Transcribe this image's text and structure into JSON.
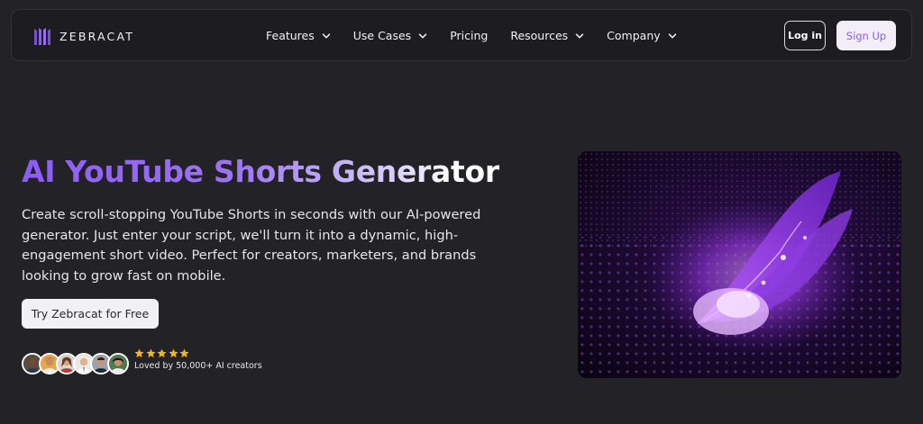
{
  "brand": {
    "name": "ZEBRACAT"
  },
  "nav": {
    "items": [
      {
        "label": "Features",
        "dropdown": true
      },
      {
        "label": "Use Cases",
        "dropdown": true
      },
      {
        "label": "Pricing",
        "dropdown": false
      },
      {
        "label": "Resources",
        "dropdown": true
      },
      {
        "label": "Company",
        "dropdown": true
      }
    ],
    "login_label": "Log in",
    "signup_label": "Sign Up"
  },
  "hero": {
    "title": "AI YouTube Shorts Generator",
    "description": "Create scroll-stopping YouTube Shorts in seconds with our AI-powered generator. Just enter your script, we'll turn it into a dynamic, high-engagement short video. Perfect for creators, marketers, and brands looking to grow fast on mobile.",
    "cta_label": "Try Zebracat for Free",
    "rating_stars": 5,
    "social_proof": "Loved by 50,000+ AI creators",
    "avatar_count": 6
  },
  "colors": {
    "background": "#232226",
    "navbar": "#1d1c20",
    "accent_purple": "#8b5cf6",
    "star_gold": "#f5b31c",
    "signup_bg": "#f1eef7"
  },
  "icons": {
    "logo": "zebracat-logo-icon",
    "dropdown": "chevron-down-icon",
    "rating": "star-icon"
  }
}
